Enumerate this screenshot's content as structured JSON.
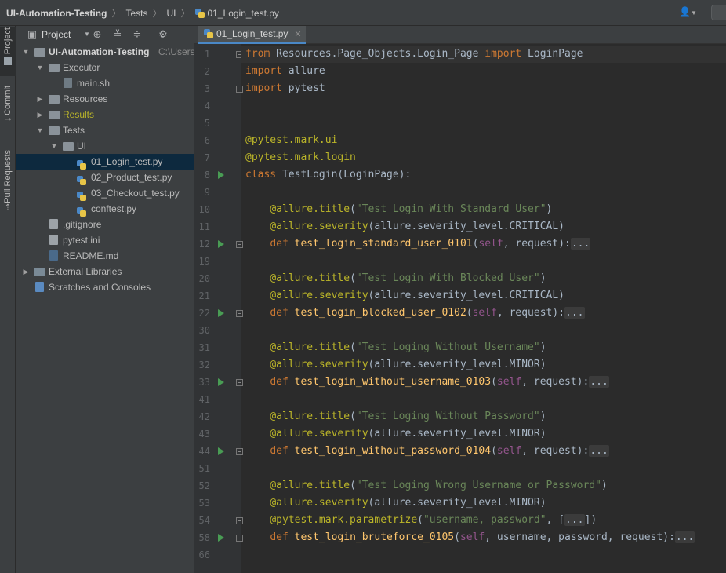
{
  "breadcrumbs": [
    {
      "label": "UI-Automation-Testing",
      "bold": true
    },
    {
      "label": "Tests"
    },
    {
      "label": "UI"
    },
    {
      "label": "01_Login_test.py",
      "icon": "python-file-icon"
    }
  ],
  "strip_tabs": [
    "Project",
    "Commit",
    "Pull Requests"
  ],
  "project_panel": {
    "title": "Project",
    "tree": [
      {
        "label": "UI-Automation-Testing",
        "extra": "C:\\Users\\",
        "depth": 0,
        "type": "folder",
        "expanded": true,
        "bold": true
      },
      {
        "label": "Executor",
        "depth": 1,
        "type": "folder",
        "expanded": true
      },
      {
        "label": "main.sh",
        "depth": 2,
        "type": "shell"
      },
      {
        "label": "Resources",
        "depth": 1,
        "type": "folder",
        "expanded": false
      },
      {
        "label": "Results",
        "depth": 1,
        "type": "folder",
        "expanded": false,
        "color": "#bbb529"
      },
      {
        "label": "Tests",
        "depth": 1,
        "type": "folder",
        "expanded": true
      },
      {
        "label": "UI",
        "depth": 2,
        "type": "folder",
        "expanded": true
      },
      {
        "label": "01_Login_test.py",
        "depth": 3,
        "type": "python",
        "selected": true
      },
      {
        "label": "02_Product_test.py",
        "depth": 3,
        "type": "python"
      },
      {
        "label": "03_Checkout_test.py",
        "depth": 3,
        "type": "python"
      },
      {
        "label": "conftest.py",
        "depth": 3,
        "type": "python"
      },
      {
        "label": ".gitignore",
        "depth": 1,
        "type": "file"
      },
      {
        "label": "pytest.ini",
        "depth": 1,
        "type": "file"
      },
      {
        "label": "README.md",
        "depth": 1,
        "type": "markdown"
      },
      {
        "label": "External Libraries",
        "depth": 0,
        "type": "library",
        "expanded": false
      },
      {
        "label": "Scratches and Consoles",
        "depth": 0,
        "type": "scratch"
      }
    ]
  },
  "editor": {
    "tab_label": "01_Login_test.py",
    "lines": [
      {
        "num": "1",
        "fold": true,
        "tokens": [
          [
            "kw",
            "from"
          ],
          [
            "t",
            " Resources.Page_Objects.Login_Page "
          ],
          [
            "kw",
            "import"
          ],
          [
            "t",
            " LoginPage"
          ]
        ]
      },
      {
        "num": "2",
        "tokens": [
          [
            "kw",
            "import"
          ],
          [
            "t",
            " allure"
          ]
        ]
      },
      {
        "num": "3",
        "fold": true,
        "tokens": [
          [
            "kw",
            "import"
          ],
          [
            "t",
            " pytest"
          ]
        ]
      },
      {
        "num": "4",
        "tokens": []
      },
      {
        "num": "5",
        "tokens": []
      },
      {
        "num": "6",
        "tokens": [
          [
            "dec",
            "@pytest.mark.ui"
          ]
        ]
      },
      {
        "num": "7",
        "tokens": [
          [
            "dec",
            "@pytest.mark.login"
          ]
        ]
      },
      {
        "num": "8",
        "run": true,
        "tokens": [
          [
            "kw",
            "class"
          ],
          [
            "t",
            " TestLogin(LoginPage):"
          ]
        ]
      },
      {
        "num": "9",
        "tokens": []
      },
      {
        "num": "10",
        "tokens": [
          [
            "t",
            "    "
          ],
          [
            "dec",
            "@allure.title"
          ],
          [
            "t",
            "("
          ],
          [
            "str",
            "\"Test Login With Standard User\""
          ],
          [
            "t",
            ")"
          ]
        ]
      },
      {
        "num": "11",
        "tokens": [
          [
            "t",
            "    "
          ],
          [
            "dec",
            "@allure.severity"
          ],
          [
            "t",
            "(allure.severity_level.CRITICAL)"
          ]
        ]
      },
      {
        "num": "12",
        "run": true,
        "fold": true,
        "tokens": [
          [
            "t",
            "    "
          ],
          [
            "kw",
            "def"
          ],
          [
            "t",
            " "
          ],
          [
            "fn",
            "test_login_standard_user_0101"
          ],
          [
            "t",
            "("
          ],
          [
            "self",
            "self"
          ],
          [
            "t",
            ", request):"
          ],
          [
            "coll",
            "..."
          ]
        ]
      },
      {
        "num": "19",
        "tokens": []
      },
      {
        "num": "20",
        "tokens": [
          [
            "t",
            "    "
          ],
          [
            "dec",
            "@allure.title"
          ],
          [
            "t",
            "("
          ],
          [
            "str",
            "\"Test Login With Blocked User\""
          ],
          [
            "t",
            ")"
          ]
        ]
      },
      {
        "num": "21",
        "tokens": [
          [
            "t",
            "    "
          ],
          [
            "dec",
            "@allure.severity"
          ],
          [
            "t",
            "(allure.severity_level.CRITICAL)"
          ]
        ]
      },
      {
        "num": "22",
        "run": true,
        "fold": true,
        "tokens": [
          [
            "t",
            "    "
          ],
          [
            "kw",
            "def"
          ],
          [
            "t",
            " "
          ],
          [
            "fn",
            "test_login_blocked_user_0102"
          ],
          [
            "t",
            "("
          ],
          [
            "self",
            "self"
          ],
          [
            "t",
            ", request):"
          ],
          [
            "coll",
            "..."
          ]
        ]
      },
      {
        "num": "30",
        "tokens": []
      },
      {
        "num": "31",
        "tokens": [
          [
            "t",
            "    "
          ],
          [
            "dec",
            "@allure.title"
          ],
          [
            "t",
            "("
          ],
          [
            "str",
            "\"Test Loging Without Username\""
          ],
          [
            "t",
            ")"
          ]
        ]
      },
      {
        "num": "32",
        "tokens": [
          [
            "t",
            "    "
          ],
          [
            "dec",
            "@allure.severity"
          ],
          [
            "t",
            "(allure.severity_level.MINOR)"
          ]
        ]
      },
      {
        "num": "33",
        "run": true,
        "fold": true,
        "tokens": [
          [
            "t",
            "    "
          ],
          [
            "kw",
            "def"
          ],
          [
            "t",
            " "
          ],
          [
            "fn",
            "test_login_without_username_0103"
          ],
          [
            "t",
            "("
          ],
          [
            "self",
            "self"
          ],
          [
            "t",
            ", request):"
          ],
          [
            "coll",
            "..."
          ]
        ]
      },
      {
        "num": "41",
        "tokens": []
      },
      {
        "num": "42",
        "tokens": [
          [
            "t",
            "    "
          ],
          [
            "dec",
            "@allure.title"
          ],
          [
            "t",
            "("
          ],
          [
            "str",
            "\"Test Loging Without Password\""
          ],
          [
            "t",
            ")"
          ]
        ]
      },
      {
        "num": "43",
        "tokens": [
          [
            "t",
            "    "
          ],
          [
            "dec",
            "@allure.severity"
          ],
          [
            "t",
            "(allure.severity_level.MINOR)"
          ]
        ]
      },
      {
        "num": "44",
        "run": true,
        "fold": true,
        "tokens": [
          [
            "t",
            "    "
          ],
          [
            "kw",
            "def"
          ],
          [
            "t",
            " "
          ],
          [
            "fn",
            "test_login_without_password_0104"
          ],
          [
            "t",
            "("
          ],
          [
            "self",
            "self"
          ],
          [
            "t",
            ", request):"
          ],
          [
            "coll",
            "..."
          ]
        ]
      },
      {
        "num": "51",
        "tokens": []
      },
      {
        "num": "52",
        "tokens": [
          [
            "t",
            "    "
          ],
          [
            "dec",
            "@allure.title"
          ],
          [
            "t",
            "("
          ],
          [
            "str",
            "\"Test Loging Wrong Username or Password\""
          ],
          [
            "t",
            ")"
          ]
        ]
      },
      {
        "num": "53",
        "tokens": [
          [
            "t",
            "    "
          ],
          [
            "dec",
            "@allure.severity"
          ],
          [
            "t",
            "(allure.severity_level.MINOR)"
          ]
        ]
      },
      {
        "num": "54",
        "fold": true,
        "tokens": [
          [
            "t",
            "    "
          ],
          [
            "dec",
            "@pytest.mark.parametrize"
          ],
          [
            "t",
            "("
          ],
          [
            "str",
            "\"username, password\""
          ],
          [
            "t",
            ", ["
          ],
          [
            "coll",
            "..."
          ],
          [
            "t",
            "])"
          ]
        ]
      },
      {
        "num": "58",
        "run": true,
        "fold": true,
        "tokens": [
          [
            "t",
            "    "
          ],
          [
            "kw",
            "def"
          ],
          [
            "t",
            " "
          ],
          [
            "fn",
            "test_login_bruteforce_0105"
          ],
          [
            "t",
            "("
          ],
          [
            "self",
            "self"
          ],
          [
            "t",
            ", username, password, request):"
          ],
          [
            "coll",
            "..."
          ]
        ]
      },
      {
        "num": "66",
        "tokens": []
      }
    ]
  }
}
